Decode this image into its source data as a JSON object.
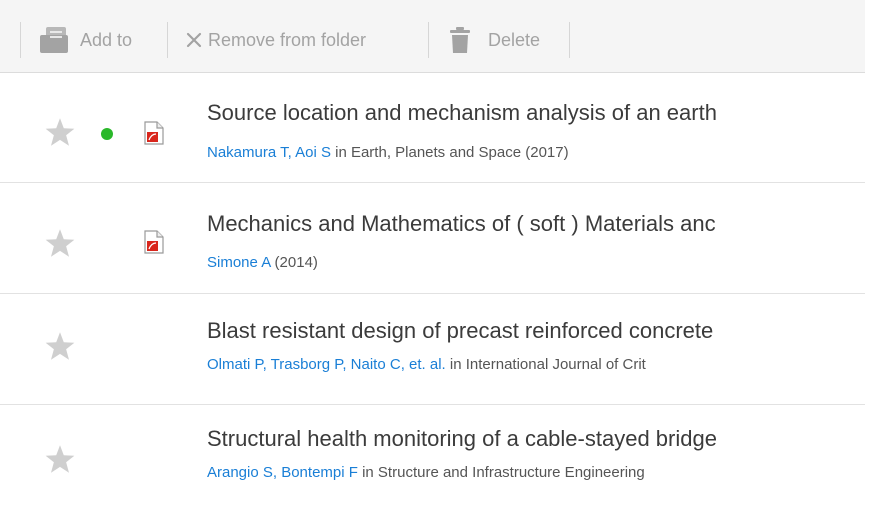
{
  "toolbar": {
    "add_to_label": "Add to",
    "remove_label": "Remove from folder",
    "delete_label": "Delete",
    "icon_color": "#a3a3a3"
  },
  "documents": [
    {
      "starred": false,
      "unread": true,
      "has_pdf": true,
      "title": "Source location and mechanism analysis of an earth",
      "authors": "Nakamura T, Aoi S",
      "source": " in Earth, Planets and Space (2017)"
    },
    {
      "starred": false,
      "unread": false,
      "has_pdf": true,
      "title": "Mechanics and Mathematics of ( soft ) Materials anc",
      "authors": "Simone A",
      "source": " (2014)"
    },
    {
      "starred": false,
      "unread": false,
      "has_pdf": false,
      "title": "Blast resistant design of precast reinforced concrete",
      "authors": "Olmati P, Trasborg P, Naito C, et. al.",
      "source": " in International Journal of Crit"
    },
    {
      "starred": false,
      "unread": false,
      "has_pdf": false,
      "title": "Structural health monitoring of a cable-stayed bridge",
      "authors": "Arangio S, Bontempi F",
      "source": " in Structure and Infrastructure Engineering"
    }
  ],
  "colors": {
    "author_link": "#1a7fd6",
    "unread_dot": "#2ab82a",
    "pdf_red": "#d9261c",
    "star_gray": "#cfcfcf"
  }
}
